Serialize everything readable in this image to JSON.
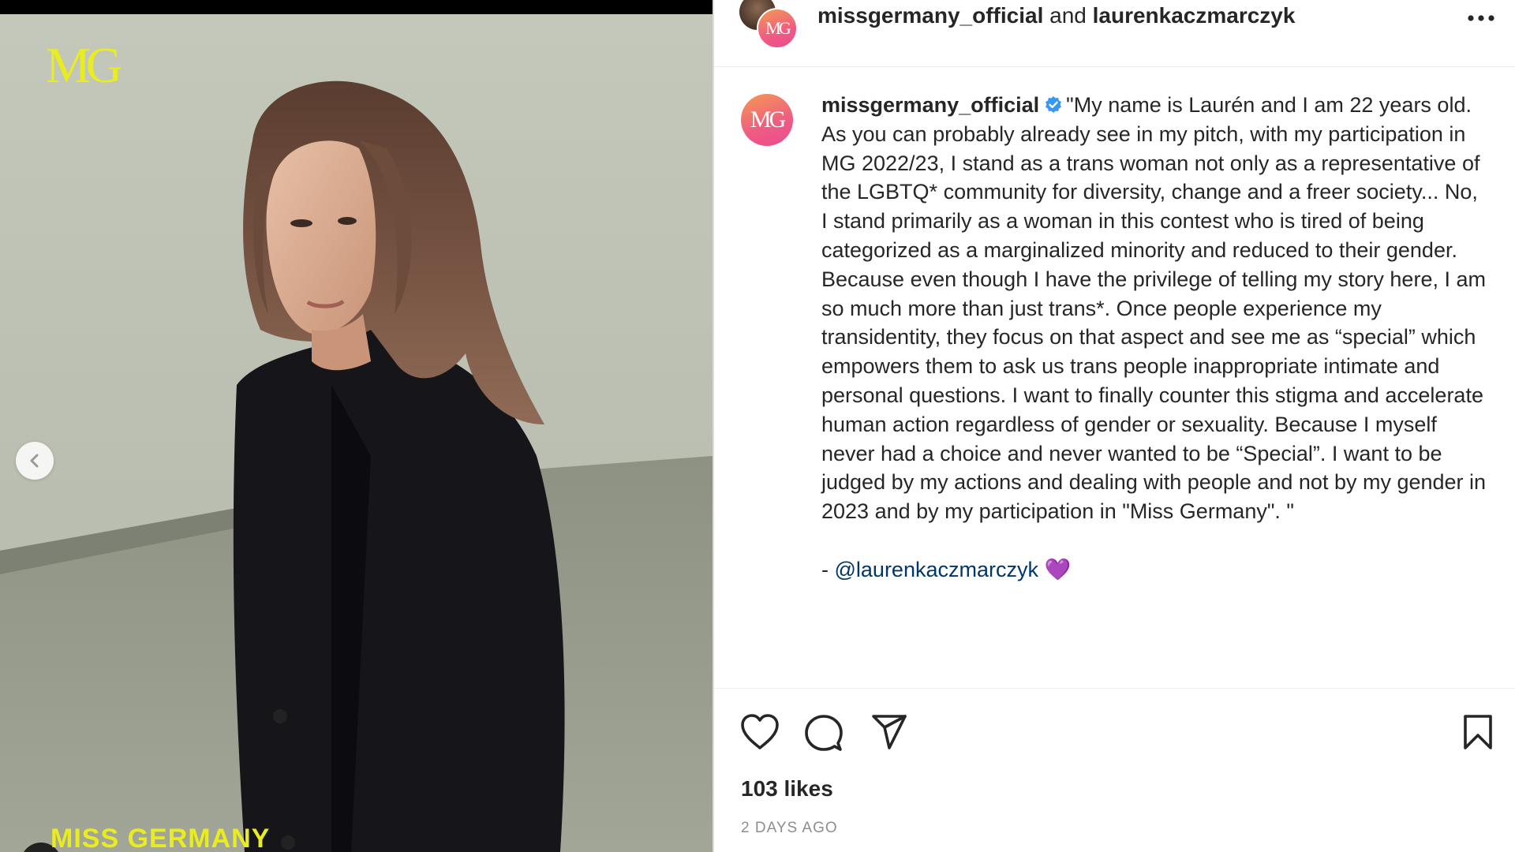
{
  "header": {
    "account_primary": "missgermany_official",
    "joiner": "and",
    "account_secondary": "laurenkaczmarczyk",
    "more_icon": "more-horizontal-icon"
  },
  "media": {
    "logo_text": "MG",
    "brand_text": "MISS GERMANY",
    "prev_icon": "chevron-left-icon",
    "accent_color": "#e9ec1f"
  },
  "avatar_text": "MG",
  "post": {
    "username": "missgermany_official",
    "verified_icon": "verified-badge-icon",
    "caption": "\"My name is Laurén and I am 22 years old. As you can probably already see in my pitch, with my participation in MG 2022/23, I stand as a trans woman not only as a representative of the LGBTQ* community for diversity, change and a freer society... No, I stand primarily as a woman in this contest who is tired of being categorized as a marginalized minority and reduced to their gender. Because even though I have the privilege of telling my story here, I am so much more than just trans*. Once people experience my transidentity, they focus on that aspect and see me as “special” which empowers them to ask us trans people inappropriate intimate and personal questions. I want to finally counter this stigma and accelerate human action regardless of gender or sexuality. Because I myself never had a choice and never wanted to be “Special”. I want to be judged by my actions and dealing with people and not by my gender in 2023 and by my participation in \"Miss Germany\". \"",
    "signoff_prefix": "- ",
    "mention": "@laurenkaczmarczyk",
    "emoji": "💜"
  },
  "actions": {
    "like_icon": "heart-icon",
    "comment_icon": "comment-icon",
    "share_icon": "paper-plane-icon",
    "save_icon": "bookmark-icon"
  },
  "likes": "103 likes",
  "timestamp": "2 DAYS AGO",
  "colors": {
    "link": "#00376b",
    "verified": "#3897f0",
    "muted": "#8e8e8e"
  }
}
